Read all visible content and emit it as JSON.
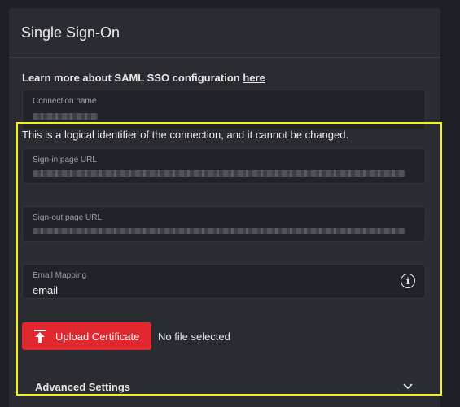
{
  "panel": {
    "title": "Single Sign-On"
  },
  "learn": {
    "text": "Learn more about SAML SSO configuration ",
    "link": "here"
  },
  "fields": {
    "connection_name": {
      "label": "Connection name"
    },
    "hint": "This is a logical identifier of the connection, and it cannot be changed.",
    "signin": {
      "label": "Sign-in page URL"
    },
    "signout": {
      "label": "Sign-out page URL"
    },
    "email": {
      "label": "Email Mapping",
      "value": "email"
    }
  },
  "upload": {
    "button_label": "Upload Certificate",
    "file_status": "No file selected"
  },
  "advanced": {
    "label": "Advanced Settings"
  },
  "colors": {
    "accent": "#e0282e",
    "highlight": "#f4f11d",
    "panel": "#2b2c31"
  }
}
